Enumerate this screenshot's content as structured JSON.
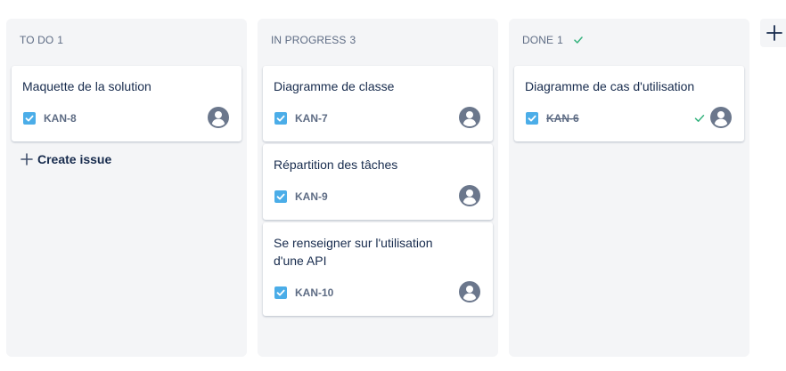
{
  "columns": [
    {
      "name": "TO DO",
      "count": "1",
      "cards": [
        {
          "title": "Maquette de la solution",
          "key": "KAN-8",
          "done": false
        }
      ],
      "create_label": "Create issue"
    },
    {
      "name": "IN PROGRESS",
      "count": "3",
      "cards": [
        {
          "title": "Diagramme de classe",
          "key": "KAN-7",
          "done": false
        },
        {
          "title": "Répartition des tâches",
          "key": "KAN-9",
          "done": false
        },
        {
          "title": "Se renseigner sur l'utilisation d'une API",
          "key": "KAN-10",
          "done": false
        }
      ]
    },
    {
      "name": "DONE",
      "count": "1",
      "cards": [
        {
          "title": "Diagramme de cas d'utilisation",
          "key": "KAN-6",
          "done": true
        }
      ]
    }
  ],
  "icons": {
    "task_type": "checkbox-task-icon",
    "avatar": "user-avatar-icon",
    "done": "check-icon",
    "create": "plus-icon",
    "add_column": "plus-icon"
  },
  "colors": {
    "column_bg": "#f4f5f7",
    "task_blue": "#4bade8",
    "avatar_gray": "#6b778c",
    "done_green": "#36b37e",
    "text_primary": "#172b4d",
    "text_secondary": "#5e6c84"
  }
}
